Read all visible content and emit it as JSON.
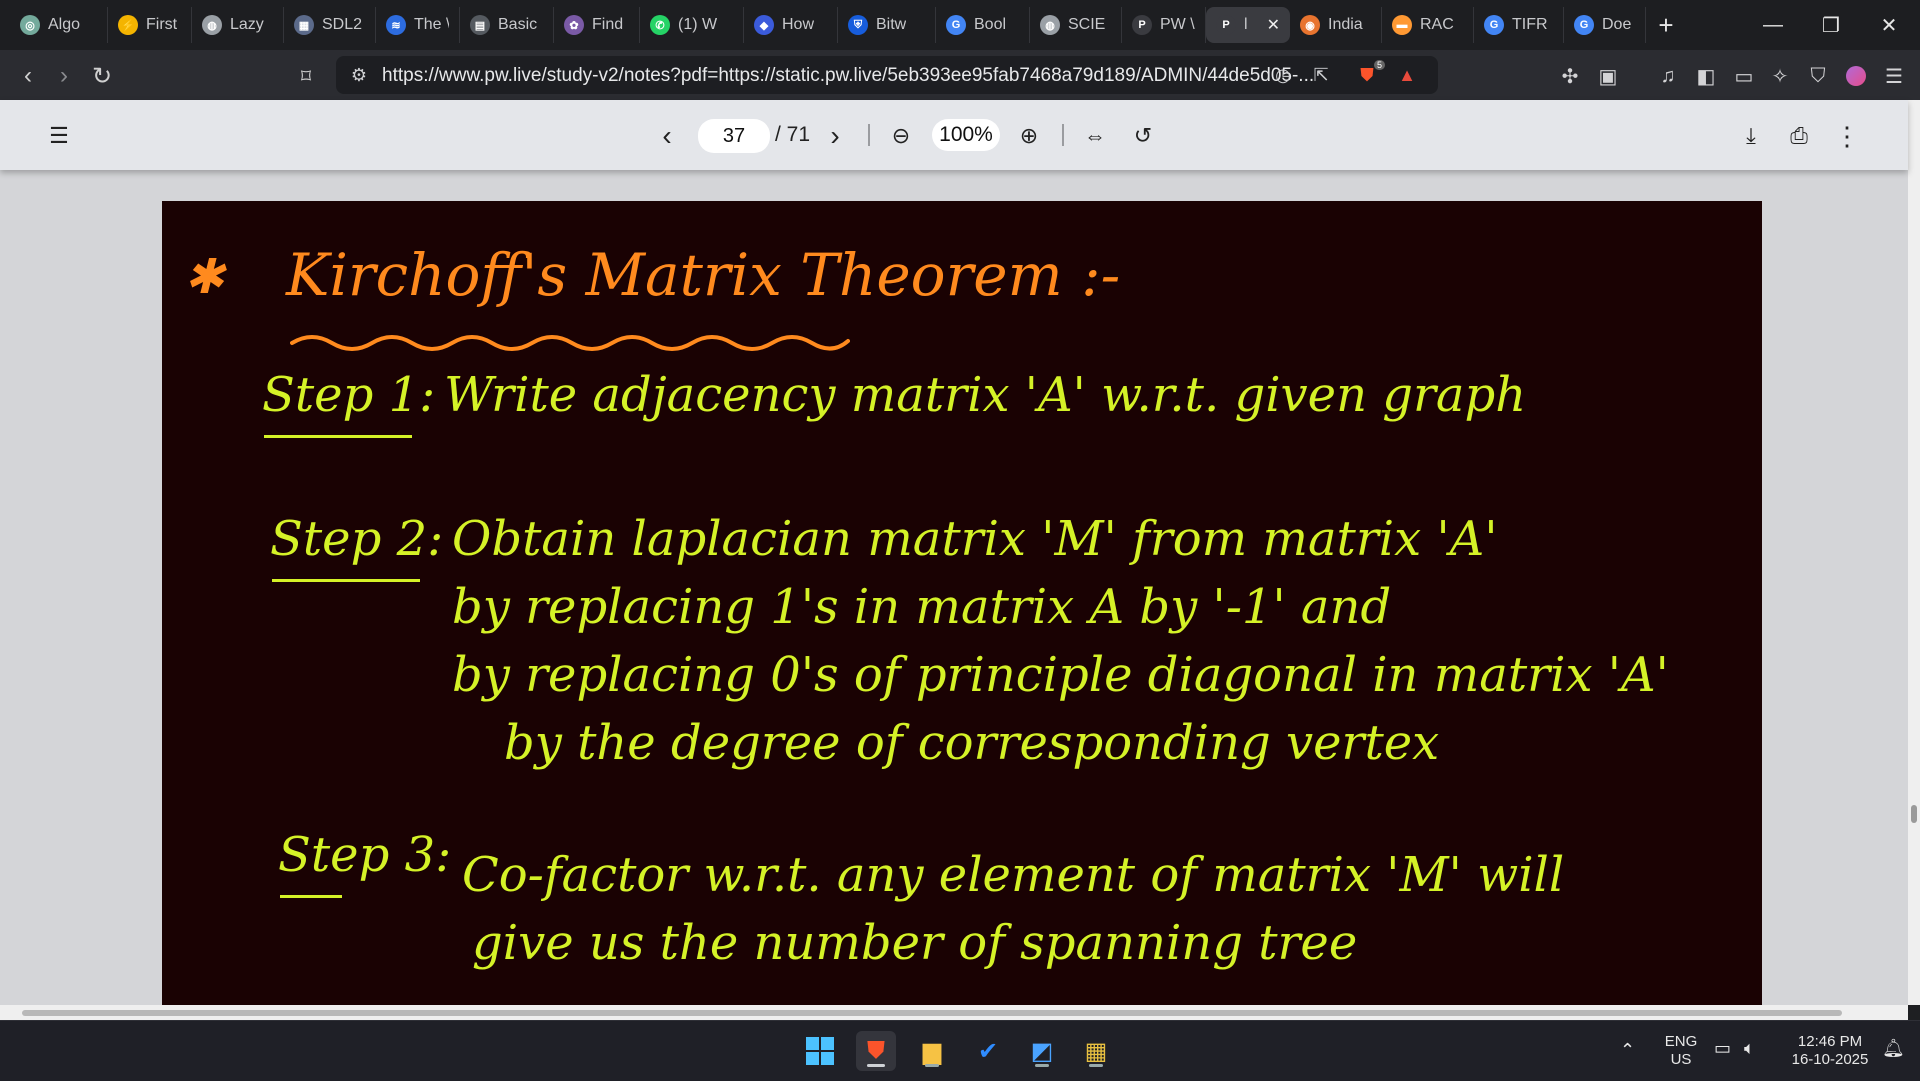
{
  "browser": {
    "tabs": [
      {
        "label": "Algo",
        "icon": "chatgpt-icon",
        "color": "#74aa9c",
        "glyph": "◎",
        "width": 98
      },
      {
        "label": "First",
        "icon": "lightning-icon",
        "color": "#f4b400",
        "glyph": "⚡",
        "width": 84
      },
      {
        "label": "Lazy",
        "icon": "globe-icon",
        "color": "#9aa0a6",
        "glyph": "◍",
        "width": 92
      },
      {
        "label": "SDL2",
        "icon": "library-icon",
        "color": "#5b6a8a",
        "glyph": "▦",
        "width": 92
      },
      {
        "label": "The \\",
        "icon": "waves-icon",
        "color": "#2d6cdf",
        "glyph": "≋",
        "width": 84
      },
      {
        "label": "Basic",
        "icon": "grid-icon",
        "color": "#555a60",
        "glyph": "▤",
        "width": 94
      },
      {
        "label": "Find",
        "icon": "brain-icon",
        "color": "#7a5aa6",
        "glyph": "✿",
        "width": 86
      },
      {
        "label": "(1) W",
        "icon": "whatsapp-icon",
        "color": "#25d366",
        "glyph": "✆",
        "width": 104
      },
      {
        "label": "How",
        "icon": "shield-app-icon",
        "color": "#3b5bdb",
        "glyph": "◆",
        "width": 94
      },
      {
        "label": "Bitw",
        "icon": "bitwarden-icon",
        "color": "#175ddc",
        "glyph": "⛨",
        "width": 98
      },
      {
        "label": "Bool",
        "icon": "google-icon",
        "color": "#4285f4",
        "glyph": "G",
        "width": 94
      },
      {
        "label": "SCIE",
        "icon": "globe-icon",
        "color": "#9aa0a6",
        "glyph": "◍",
        "width": 92
      },
      {
        "label": "PW \\",
        "icon": "pw-icon",
        "color": "#3a3b40",
        "glyph": "P",
        "width": 84
      },
      {
        "label": "l",
        "icon": "pw-icon",
        "color": "#3a3b40",
        "glyph": "P",
        "width": 84,
        "active": true
      },
      {
        "label": "India",
        "icon": "india-icon",
        "color": "#e8742f",
        "glyph": "◉",
        "width": 92
      },
      {
        "label": "RAC",
        "icon": "india-flag-icon",
        "color": "#ff9933",
        "glyph": "▬",
        "width": 92
      },
      {
        "label": "TIFR",
        "icon": "google-icon",
        "color": "#4285f4",
        "glyph": "G",
        "width": 90
      },
      {
        "label": "Doe",
        "icon": "google-icon",
        "color": "#4285f4",
        "glyph": "G",
        "width": 82
      }
    ],
    "url": "https://www.pw.live/study-v2/notes?pdf=https://static.pw.live/5eb393ee95fab7468a79d189/ADMIN/44de5d05-...",
    "shield_count": "5"
  },
  "pdf_toolbar": {
    "current_page": "37",
    "total_pages": "/ 71",
    "zoom": "100%"
  },
  "note": {
    "title": "Kirchoff's Matrix Theorem :-",
    "bullet": "✱",
    "step1_label": "Step 1:",
    "step1_text": "Write adjacency matrix 'A' w.r.t. given graph",
    "step2_label": "Step 2:",
    "step2_line1": "Obtain laplacian matrix 'M' from matrix 'A'",
    "step2_line2": "by replacing 1's in matrix A by '-1' and",
    "step2_line3": "by replacing 0's of principle diagonal in matrix 'A'",
    "step2_line4": "by the degree of corresponding vertex",
    "step3_label": "Step 3:",
    "step3_line1": "Co-factor w.r.t. any element of matrix 'M' will",
    "step3_line2": "give us the number of spanning tree"
  },
  "taskbar": {
    "lang_line1": "ENG",
    "lang_line2": "US",
    "time": "12:46 PM",
    "date": "16-10-2025"
  }
}
